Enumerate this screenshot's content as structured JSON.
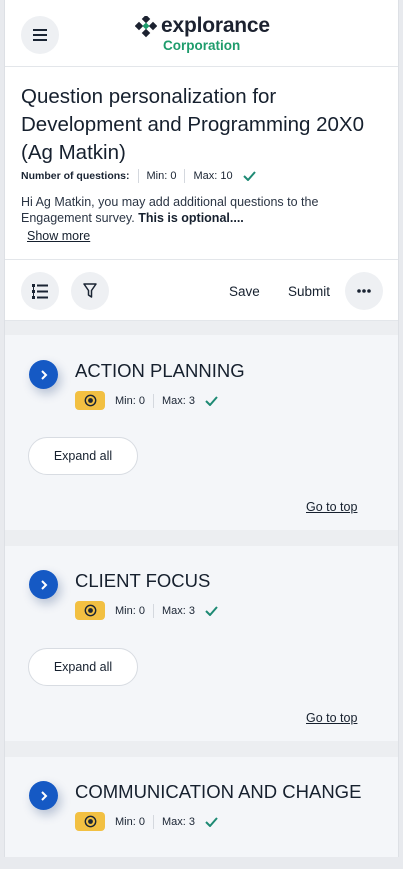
{
  "header": {
    "logo_text": "explorance",
    "logo_sub": "Corporation",
    "brand_color": "#1e9c6c",
    "menu_icon": "hamburger-icon"
  },
  "info": {
    "title": "Question personalization for Development and Programming 20X0 (Ag Matkin)",
    "num_questions_label": "Number of questions:",
    "min": "Min: 0",
    "max": "Max: 10",
    "description_plain": "Hi Ag Matkin, you may add additional questions to the Engagement survey. ",
    "description_bold": "This is optional....",
    "show_more": "Show more"
  },
  "toolbar": {
    "list_icon": "list-icon",
    "filter_icon": "filter-icon",
    "save_label": "Save",
    "submit_label": "Submit",
    "more_icon": "more-icon"
  },
  "sections": [
    {
      "title": "ACTION PLANNING",
      "min": "Min: 0",
      "max": "Max: 3",
      "expand_label": "Expand all",
      "go_top_label": "Go to top"
    },
    {
      "title": "CLIENT FOCUS",
      "min": "Min: 0",
      "max": "Max: 3",
      "expand_label": "Expand all",
      "go_top_label": "Go to top"
    },
    {
      "title": "COMMUNICATION AND CHANGE",
      "min": "Min: 0",
      "max": "Max: 3"
    }
  ],
  "colors": {
    "accent": "#1559c4",
    "badge": "#f2c042",
    "check": "#1e8a74"
  }
}
